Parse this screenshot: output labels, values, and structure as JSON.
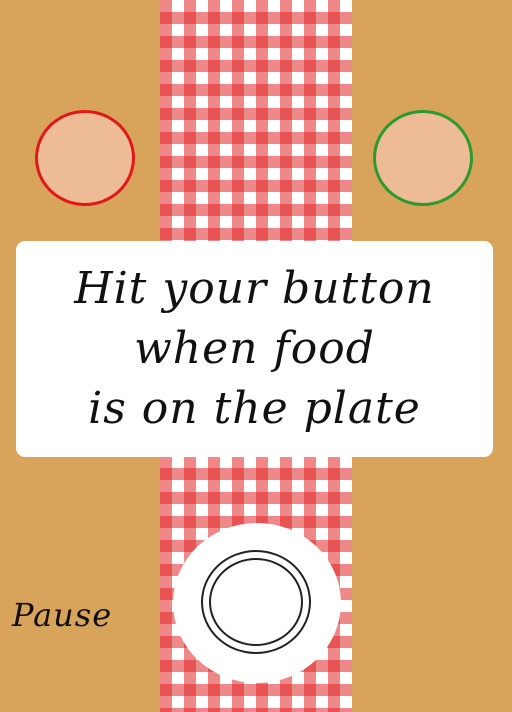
{
  "game": {
    "message_lines": [
      "Hit your button",
      "when food",
      "is on the plate"
    ],
    "pause_label": "Pause"
  },
  "colors": {
    "table": "#d8a45c",
    "tablecloth_check": "#e22828",
    "player_left_border": "#e01818",
    "player_right_border": "#2d9a2d",
    "player_button_fill": "#edbb96",
    "card": "#ffffff"
  }
}
